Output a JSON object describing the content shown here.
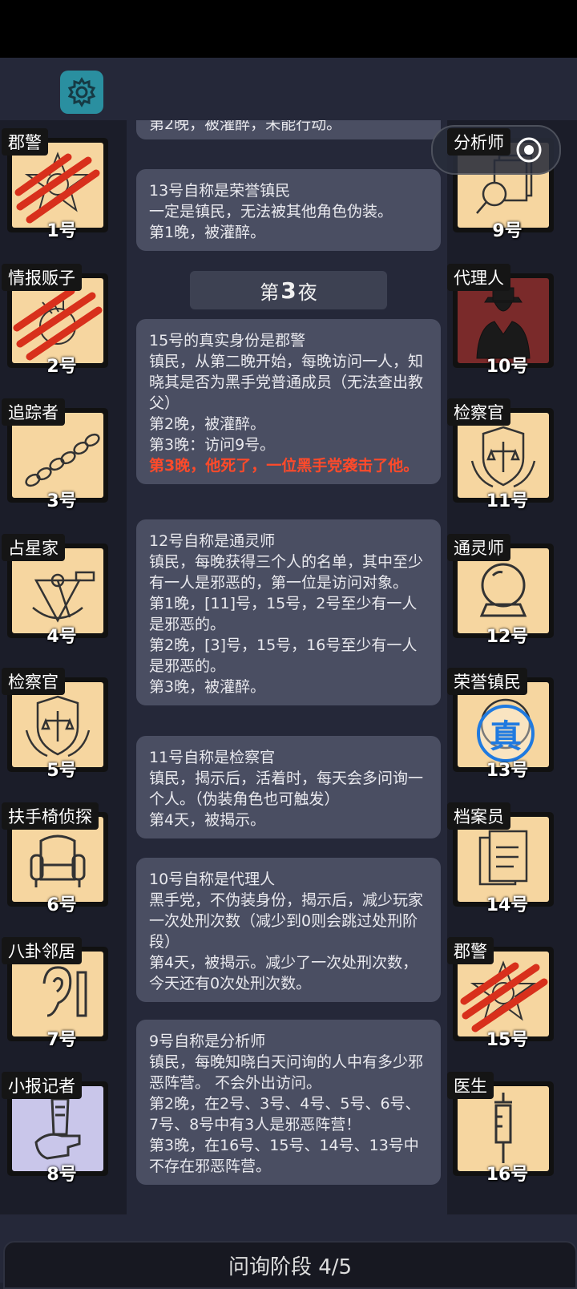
{
  "colors": {
    "tile": "#f6d6a0",
    "tile_dark": "#7a2a2a",
    "tile_violet": "#c9c6ea",
    "accent_red": "#ff4a2a",
    "bubble": "#4a4e62",
    "settings": "#2a8fa0"
  },
  "left_players": [
    {
      "role": "郡警",
      "number": "1号",
      "icon": "sheriff-badge-icon",
      "killed": true
    },
    {
      "role": "情报贩子",
      "number": "2号",
      "icon": "info-broker-icon",
      "killed": true
    },
    {
      "role": "追踪者",
      "number": "3号",
      "icon": "footprints-icon",
      "killed": false
    },
    {
      "role": "占星家",
      "number": "4号",
      "icon": "sextant-icon",
      "killed": false
    },
    {
      "role": "检察官",
      "number": "5号",
      "icon": "scales-shield-icon",
      "killed": false
    },
    {
      "role": "扶手椅侦探",
      "number": "6号",
      "icon": "armchair-icon",
      "killed": false
    },
    {
      "role": "八卦邻居",
      "number": "7号",
      "icon": "ear-icon",
      "killed": false
    },
    {
      "role": "小报记者",
      "number": "8号",
      "icon": "newspaper-hand-icon",
      "killed": false
    }
  ],
  "right_players": [
    {
      "role": "分析师",
      "number": "9号",
      "icon": "magnifier-documents-icon",
      "killed": false
    },
    {
      "role": "代理人",
      "number": "10号",
      "icon": "agent-suit-icon",
      "killed": false
    },
    {
      "role": "检察官",
      "number": "11号",
      "icon": "scales-shield-icon",
      "killed": false
    },
    {
      "role": "通灵师",
      "number": "12号",
      "icon": "crystal-ball-icon",
      "killed": false
    },
    {
      "role": "荣誉镇民",
      "number": "13号",
      "icon": "honor-townsfolk-icon",
      "killed": false,
      "stamp": "真"
    },
    {
      "role": "档案员",
      "number": "14号",
      "icon": "documents-icon",
      "killed": false
    },
    {
      "role": "郡警",
      "number": "15号",
      "icon": "sheriff-badge-icon",
      "killed": true
    },
    {
      "role": "医生",
      "number": "16号",
      "icon": "syringe-icon",
      "killed": false
    }
  ],
  "messages": {
    "top_partial": "第2晚，被灌醉，未能行动。",
    "m13": [
      "13号自称是荣誉镇民",
      "一定是镇民，无法被其他角色伪装。",
      "第1晚，被灌醉。"
    ],
    "night_prefix": "第",
    "night_num": "3",
    "night_suffix": "夜",
    "m15": [
      "15号的真实身份是郡警",
      "镇民，从第二晚开始，每晚访问一人，知晓其是否为黑手党普通成员（无法查出教父）",
      "第2晚，被灌醉。",
      "第3晚：访问9号。"
    ],
    "m15_death": "第3晚，他死了，一位黑手党袭击了他。",
    "m12": [
      "12号自称是通灵师",
      "镇民，每晚获得三个人的名单，其中至少有一人是邪恶的，第一位是访问对象。",
      "第1晚，[11]号，15号，2号至少有一人是邪恶的。",
      "第2晚，[3]号，15号，16号至少有一人是邪恶的。",
      "第3晚，被灌醉。"
    ],
    "m11": [
      "11号自称是检察官",
      "镇民，揭示后，活着时，每天会多问询一个人。（伪装角色也可触发）",
      "第4天，被揭示。"
    ],
    "m10": [
      "10号自称是代理人",
      "黑手党，不伪装身份，揭示后，减少玩家一次处刑次数（减少到0则会跳过处刑阶段）",
      "第4天，被揭示。减少了一次处刑次数，今天还有0次处刑次数。"
    ],
    "m9": [
      "9号自称是分析师",
      "镇民，每晚知晓白天问询的人中有多少邪恶阵营。 不会外出访问。",
      "第2晚，在2号、3号、4号、5号、6号、7号、8号中有3人是邪恶阵营！",
      "第3晚，在16号、15号、14号、13号中不存在邪恶阵营。"
    ]
  },
  "bottom": {
    "phase": "问询阶段 4/5"
  }
}
